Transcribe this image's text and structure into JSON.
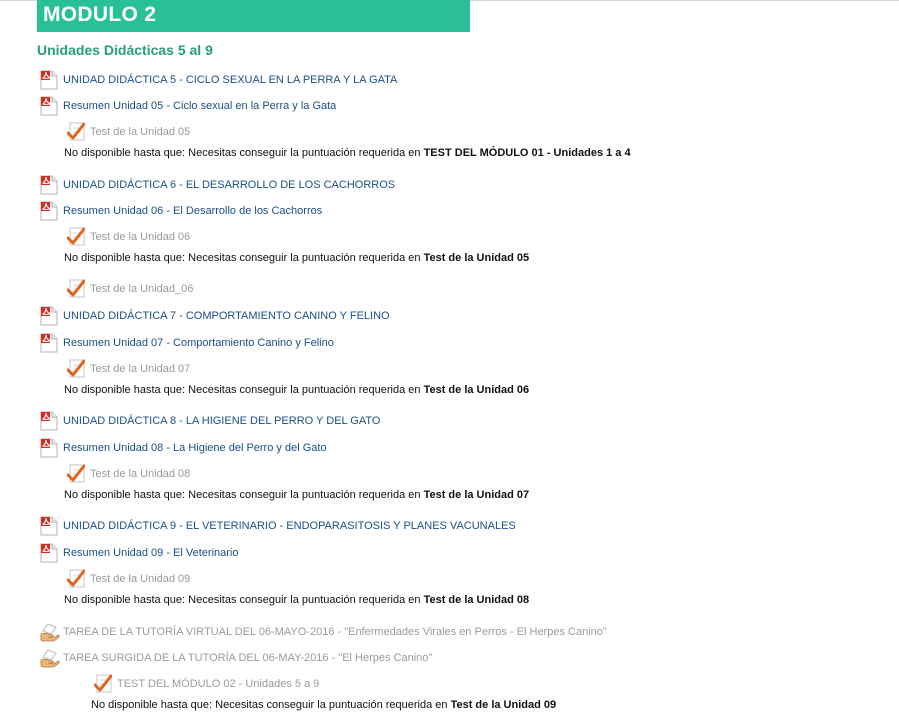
{
  "module": {
    "header": "MODULO 2",
    "section_title": "Unidades Didácticas 5 al 9"
  },
  "restriction_prefix": "No disponible hasta que: Necesitas conseguir la puntuación requerida en ",
  "items": [
    {
      "label": "UNIDAD DIDÁCTICA 5 - CICLO SEXUAL EN LA PERRA Y LA GATA"
    },
    {
      "label": "Resumen Unidad 05 - Ciclo sexual en la Perra y la Gata"
    },
    {
      "label": "Test de la Unidad 05",
      "restriction": "TEST DEL MÓDULO 01 - Unidades 1 a 4"
    },
    {
      "label": "UNIDAD DIDÁCTICA 6 - EL DESARROLLO DE LOS CACHORROS"
    },
    {
      "label": "Resumen Unidad 06 - El Desarrollo de los Cachorros"
    },
    {
      "label": "Test de la Unidad 06",
      "restriction": "Test de la Unidad 05"
    },
    {
      "label": "Test de la Unidad_06"
    },
    {
      "label": "UNIDAD DIDÁCTICA 7 - COMPORTAMIENTO CANINO Y FELINO"
    },
    {
      "label": "Resumen Unidad 07 - Comportamiento Canino y Felino"
    },
    {
      "label": "Test de la Unidad 07",
      "restriction": "Test de la Unidad 06"
    },
    {
      "label": "UNIDAD DIDÁCTICA 8 - LA HIGIENE DEL PERRO Y DEL GATO"
    },
    {
      "label": "Resumen Unidad 08 - La Higiene del Perro y del Gato"
    },
    {
      "label": "Test de la Unidad 08",
      "restriction": "Test de la Unidad 07"
    },
    {
      "label": "UNIDAD DIDÁCTICA 9 - EL VETERINARIO - ENDOPARASITOSIS Y PLANES VACUNALES"
    },
    {
      "label": "Resumen Unidad 09 - El Veterinario"
    },
    {
      "label": "Test de la Unidad 09",
      "restriction": "Test de la Unidad 08"
    },
    {
      "label": "TAREA DE LA TUTORÍA VIRTUAL DEL 06-MAYO-2016 - \"Enfermedades Virales en Perros - El Herpes Canino\""
    },
    {
      "label": "TAREA SURGIDA DE LA TUTORÍA DEL 06-MAY-2016 - \"El Herpes Canino\""
    },
    {
      "label": "TEST DEL MÓDULO 02 - Unidades 5 a 9",
      "restriction": "Test de la Unidad 09"
    }
  ]
}
